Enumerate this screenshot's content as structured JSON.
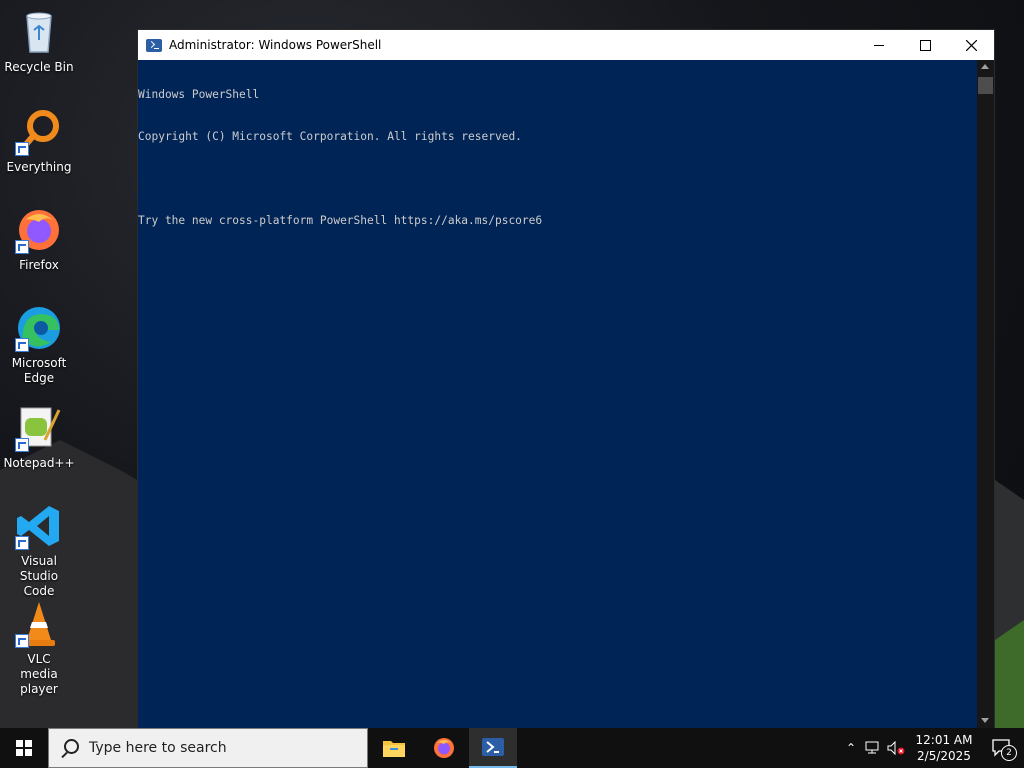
{
  "desktop": {
    "icons": [
      {
        "label": "Recycle Bin"
      },
      {
        "label": "Everything"
      },
      {
        "label": "Firefox"
      },
      {
        "label": "Microsoft Edge"
      },
      {
        "label": "Notepad++"
      },
      {
        "label": "Visual Studio Code"
      },
      {
        "label": "VLC media player"
      }
    ]
  },
  "window": {
    "title": "Administrator: Windows PowerShell",
    "minimize_icon": "minimize-icon",
    "maximize_icon": "maximize-icon",
    "close_icon": "close-icon",
    "console_lines": [
      "Windows PowerShell",
      "Copyright (C) Microsoft Corporation. All rights reserved.",
      "",
      "Try the new cross-platform PowerShell https://aka.ms/pscore6"
    ],
    "console_bg": "#012456",
    "console_fg": "#cccccc"
  },
  "taskbar": {
    "search_placeholder": "Type here to search",
    "apps": [
      "File Explorer",
      "Firefox",
      "Windows PowerShell"
    ],
    "clock_time": "12:01 AM",
    "clock_date": "2/5/2025",
    "notification_count": "2"
  }
}
